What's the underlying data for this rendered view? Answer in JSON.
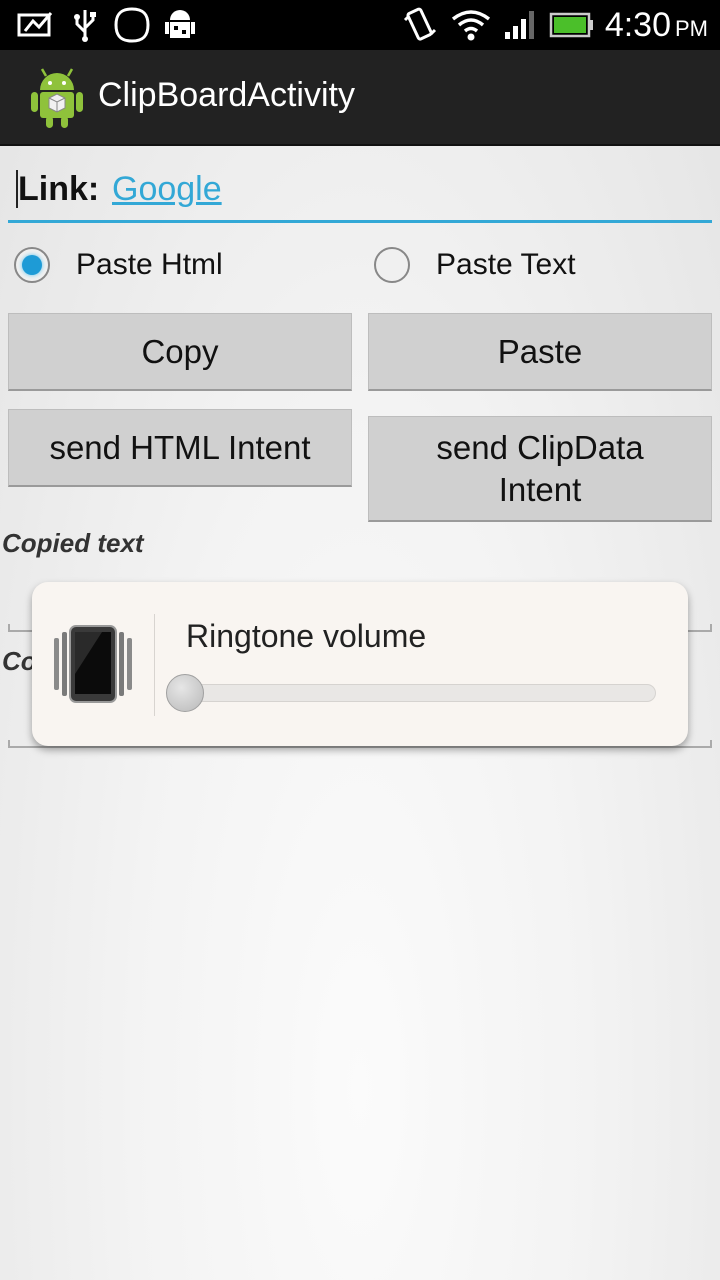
{
  "status_bar": {
    "time": "4:30",
    "ampm": "PM",
    "icons": [
      "picture-message-icon",
      "usb-icon",
      "blank-notification-icon",
      "android-debug-icon",
      "vibrate-icon",
      "wifi-icon",
      "signal-icon",
      "battery-icon"
    ],
    "battery_color": "#4bbf2a"
  },
  "action_bar": {
    "title": "ClipBoardActivity",
    "icon": "android-app-icon"
  },
  "link_field": {
    "label": "Link:",
    "link_text": "Google",
    "accent": "#33a8d6"
  },
  "radios": [
    {
      "label": "Paste Html",
      "checked": true
    },
    {
      "label": "Paste Text",
      "checked": false
    }
  ],
  "buttons": {
    "copy": "Copy",
    "paste": "Paste",
    "send_html": "send HTML Intent",
    "send_clip_line1": "send ClipData",
    "send_clip_line2": "Intent"
  },
  "labels": {
    "copied_text": "Copied text",
    "partial": "Co"
  },
  "volume_toast": {
    "title": "Ringtone volume",
    "level": 0,
    "icon": "vibrate-phone-icon"
  }
}
